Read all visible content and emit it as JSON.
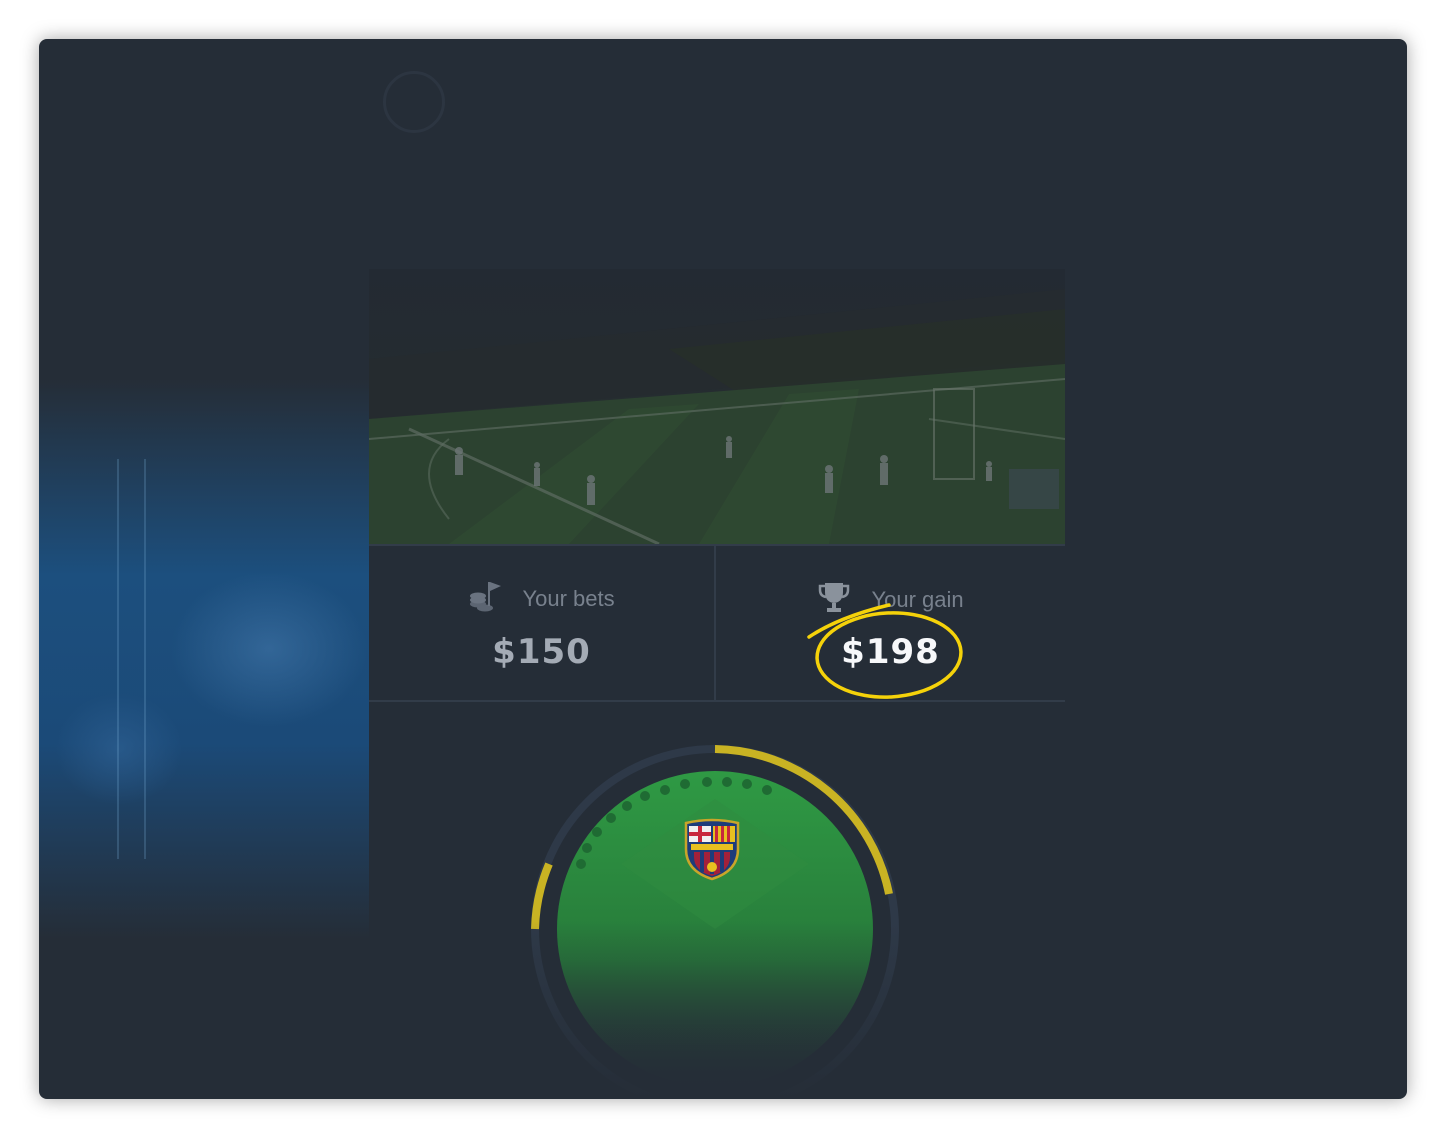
{
  "stats": {
    "bets": {
      "label": "Your bets",
      "value": "$150",
      "icon": "coins-flag-icon"
    },
    "gain": {
      "label": "Your gain",
      "value": "$198",
      "icon": "trophy-icon"
    }
  },
  "colors": {
    "background": "#252d37",
    "highlight": "#f5d20a",
    "gauge_yellow": "#c9b323",
    "field_green": "#2f9a44"
  },
  "team": {
    "crest": "fc-barcelona-crest-icon"
  }
}
